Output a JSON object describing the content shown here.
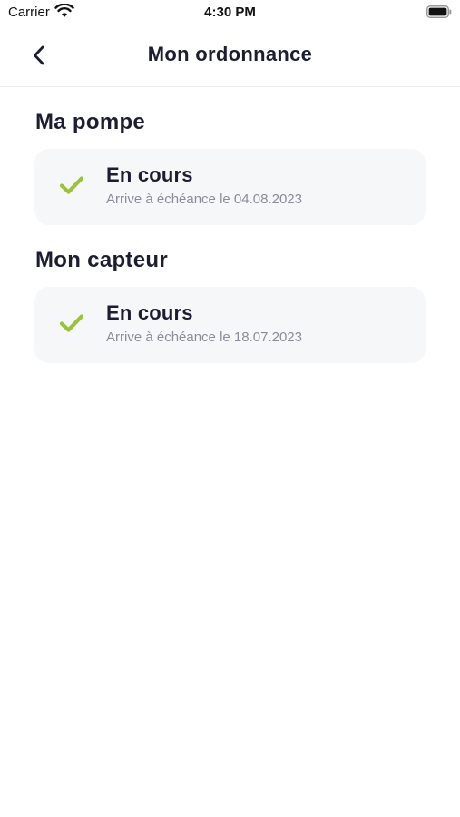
{
  "status_bar": {
    "carrier": "Carrier",
    "time": "4:30 PM"
  },
  "nav": {
    "title": "Mon ordonnance",
    "back_icon": "chevron-left-icon"
  },
  "sections": [
    {
      "title": "Ma pompe",
      "card": {
        "status": "En cours",
        "expiry": "Arrive à échéance le 04.08.2023",
        "icon": "check-icon"
      }
    },
    {
      "title": "Mon capteur",
      "card": {
        "status": "En cours",
        "expiry": "Arrive à échéance le 18.07.2023",
        "icon": "check-icon"
      }
    }
  ],
  "colors": {
    "accent_check": "#9ac33a",
    "card_background": "#f6f7f9",
    "text_primary": "#1c1d33",
    "text_secondary": "#8a8d99"
  }
}
